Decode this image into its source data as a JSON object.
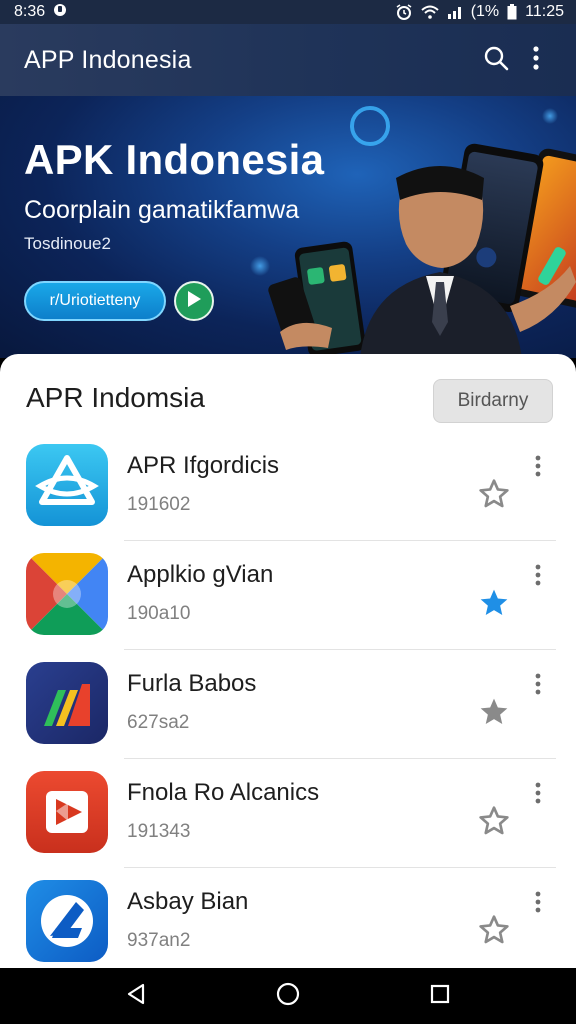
{
  "status_bar": {
    "time_left": "8:36",
    "battery_percent": "(1%",
    "time_right": "11:25",
    "icons": [
      "notification-icon",
      "alarm-icon",
      "wifi-icon",
      "signal-icon",
      "battery-icon"
    ]
  },
  "app_bar": {
    "title": "APP Indonesia",
    "actions": [
      "search-icon",
      "more-vert-icon"
    ]
  },
  "hero": {
    "title": "APK Indonesia",
    "subtitle": "Coorplain gamatikfamwa",
    "caption": "Tosdinoue2",
    "cta_label": "r/Uriotietteny",
    "play_icon": "play-icon"
  },
  "section": {
    "title": "APR Indomsia",
    "button_label": "Birdarny"
  },
  "apps": [
    {
      "name": "APR Ifgordicis",
      "meta": "191602",
      "starred": false,
      "icon": "triangle-swirl-icon"
    },
    {
      "name": "Applkio gVian",
      "meta": "190a10",
      "starred": true,
      "icon": "colorful-shape-icon"
    },
    {
      "name": "Furla Babos",
      "meta": "627sa2",
      "starred": false,
      "icon": "stripes-chart-icon"
    },
    {
      "name": "Fnola Ro Alcanics",
      "meta": "191343",
      "starred": false,
      "icon": "play-store-icon"
    },
    {
      "name": "Asbay Bian",
      "meta": "937an2",
      "starred": false,
      "icon": "blue-swoosh-icon"
    }
  ],
  "colors": {
    "app_bar": "#1f3358",
    "hero_bg": "#143f86",
    "cta": "#1aa8e8",
    "play": "#1f9d5a",
    "star_active": "#1f8fe6",
    "star_inactive": "#8a8a8a"
  },
  "nav_bar": [
    "back-icon",
    "home-icon",
    "recents-icon"
  ]
}
